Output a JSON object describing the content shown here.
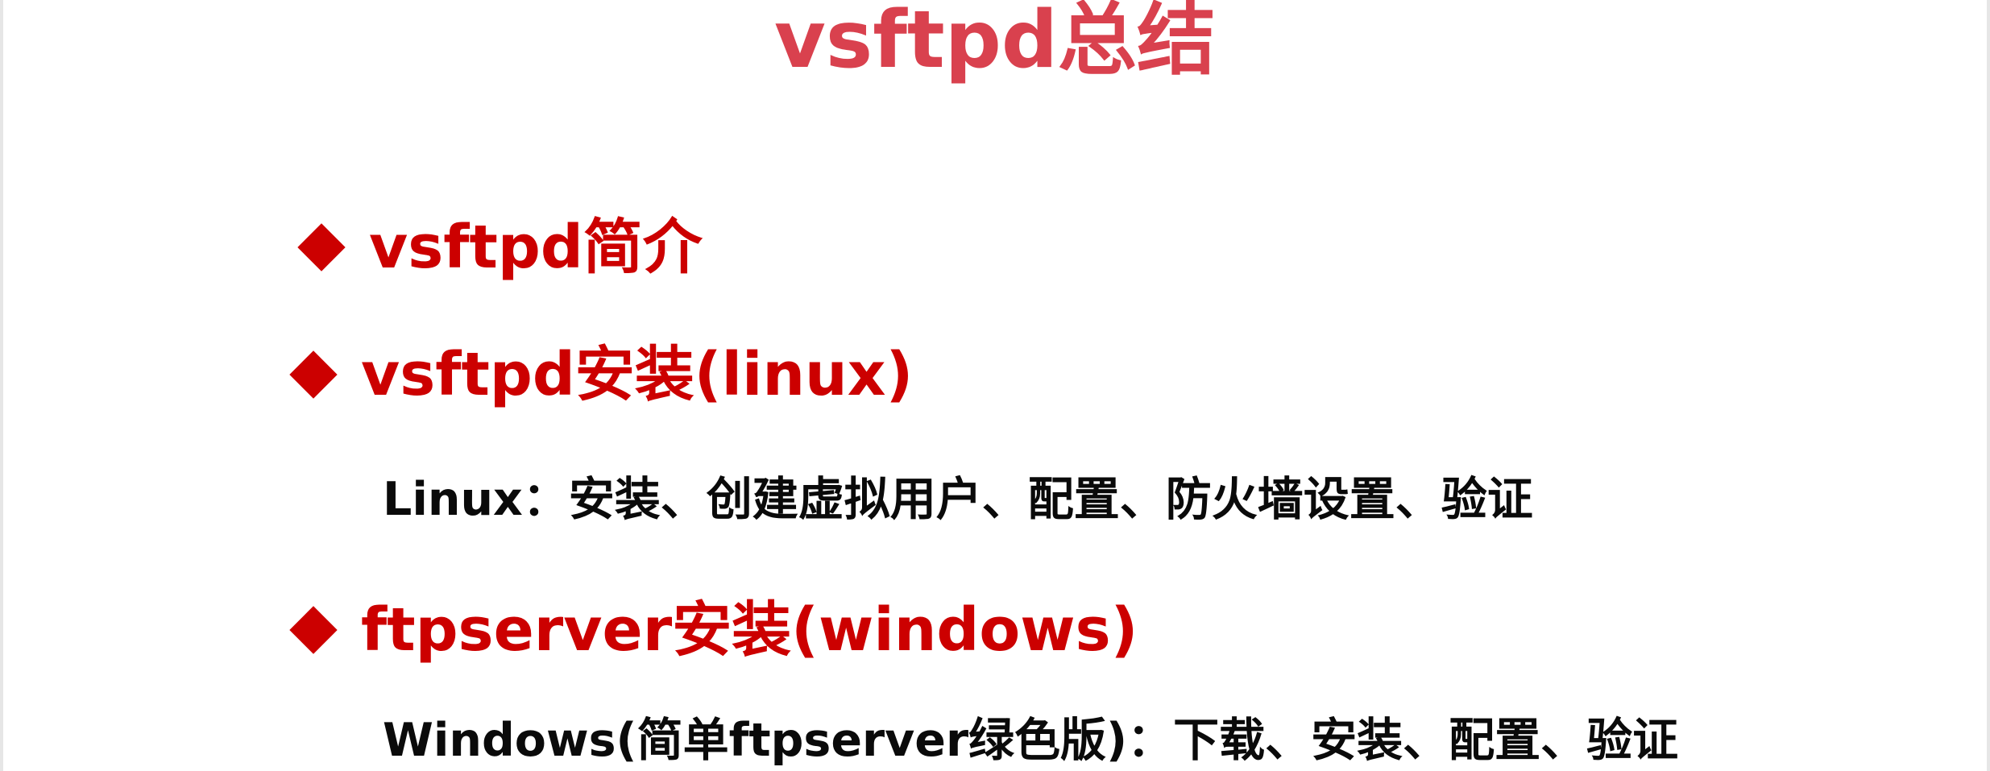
{
  "slide": {
    "title": "vsftpd总结",
    "colors": {
      "title": "#d9414e",
      "bullet": "#cc0000",
      "body": "#0a0a0a",
      "background": "#ffffff"
    },
    "bullet_icon": "diamond-icon",
    "items": [
      {
        "heading": "vsftpd简介",
        "detail": ""
      },
      {
        "heading": "vsftpd安装(linux)",
        "detail": "Linux：安装、创建虚拟用户、配置、防火墙设置、验证"
      },
      {
        "heading": "ftpserver安装(windows)",
        "detail": "Windows(简单ftpserver绿色版)：下载、安装、配置、验证"
      }
    ]
  }
}
